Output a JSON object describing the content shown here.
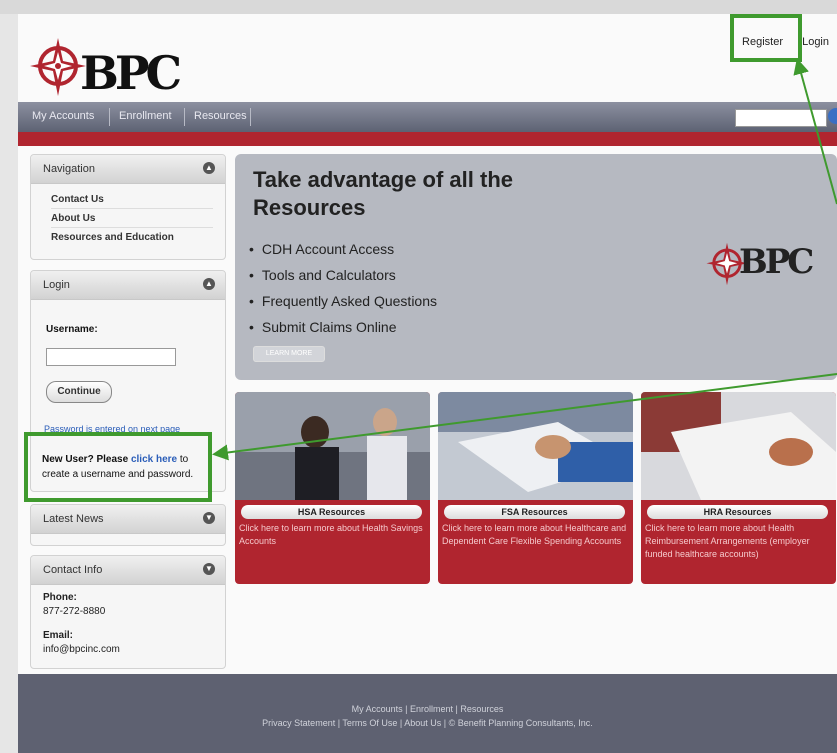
{
  "header": {
    "logo_text": "BPC",
    "register_label": "Register",
    "login_label": "Login"
  },
  "navbar": {
    "items": [
      "My Accounts",
      "Enrollment",
      "Resources"
    ]
  },
  "sidebar": {
    "navigation": {
      "title": "Navigation",
      "links": [
        "Contact Us",
        "About Us",
        "Resources and Education"
      ]
    },
    "login": {
      "title": "Login",
      "username_label": "Username:",
      "username_value": "",
      "continue_label": "Continue",
      "forgot_text": "Password is entered on next page",
      "new_user_prefix": "New User? Please",
      "new_user_link": "click here",
      "new_user_suffix": "to create a username and password."
    },
    "latest_news": {
      "title": "Latest News"
    },
    "contact": {
      "title": "Contact Info",
      "phone_label": "Phone:",
      "phone": "877-272-8880",
      "email_label": "Email:",
      "email": "info@bpcinc.com"
    }
  },
  "hero": {
    "title": "Take advantage of all the Resources",
    "bullets": [
      "CDH Account Access",
      "Tools and Calculators",
      "Frequently Asked Questions",
      "Submit Claims Online"
    ],
    "learn_more": "LEARN MORE",
    "logo_text": "BPC"
  },
  "cards": [
    {
      "title": "HSA Resources",
      "desc": "Click here to learn more about Health Savings Accounts"
    },
    {
      "title": "FSA Resources",
      "desc": "Click here to learn more about Healthcare and Dependent Care Flexible Spending Accounts"
    },
    {
      "title": "HRA Resources",
      "desc": "Click here to learn more about Health Reimbursement Arrangements (employer funded healthcare accounts)"
    }
  ],
  "footer": {
    "line1": "My Accounts  |  Enrollment  |  Resources",
    "line2": "Privacy Statement  |  Terms Of Use  |  About Us  |  © Benefit Planning Consultants, Inc."
  },
  "colors": {
    "brand_red": "#b0252f",
    "navbar": "#5d6273",
    "annotation_green": "#3f9a2e"
  }
}
